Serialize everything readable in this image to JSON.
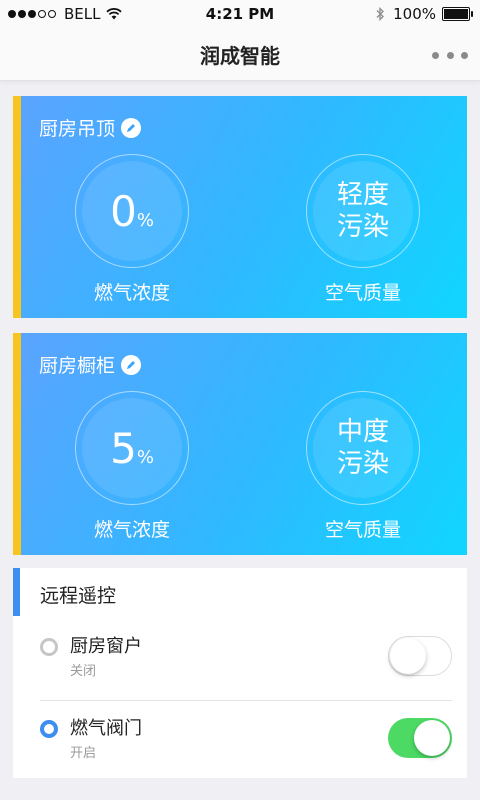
{
  "status_bar": {
    "carrier": "BELL",
    "time": "4:21 PM",
    "battery": "100%"
  },
  "nav": {
    "title": "润成智能"
  },
  "cards": [
    {
      "title": "厨房吊顶",
      "gas_value": "0",
      "gas_unit": "%",
      "gas_label": "燃气浓度",
      "air_value_line1": "轻度",
      "air_value_line2": "污染",
      "air_label": "空气质量"
    },
    {
      "title": "厨房橱柜",
      "gas_value": "5",
      "gas_unit": "%",
      "gas_label": "燃气浓度",
      "air_value_line1": "中度",
      "air_value_line2": "污染",
      "air_label": "空气质量"
    }
  ],
  "remote": {
    "title": "远程遥控",
    "devices": [
      {
        "name": "厨房窗户",
        "status": "关闭",
        "on": false
      },
      {
        "name": "燃气阀门",
        "status": "开启",
        "on": true
      }
    ]
  },
  "colors": {
    "card_gradient_start": "#5aa3ff",
    "card_gradient_end": "#10d6ff",
    "card_accent": "#f7c51e",
    "remote_accent": "#3c8ef0",
    "toggle_on": "#4cd964"
  },
  "icons": [
    "wifi-icon",
    "bluetooth-icon",
    "battery-icon",
    "more-icon",
    "edit-icon"
  ]
}
